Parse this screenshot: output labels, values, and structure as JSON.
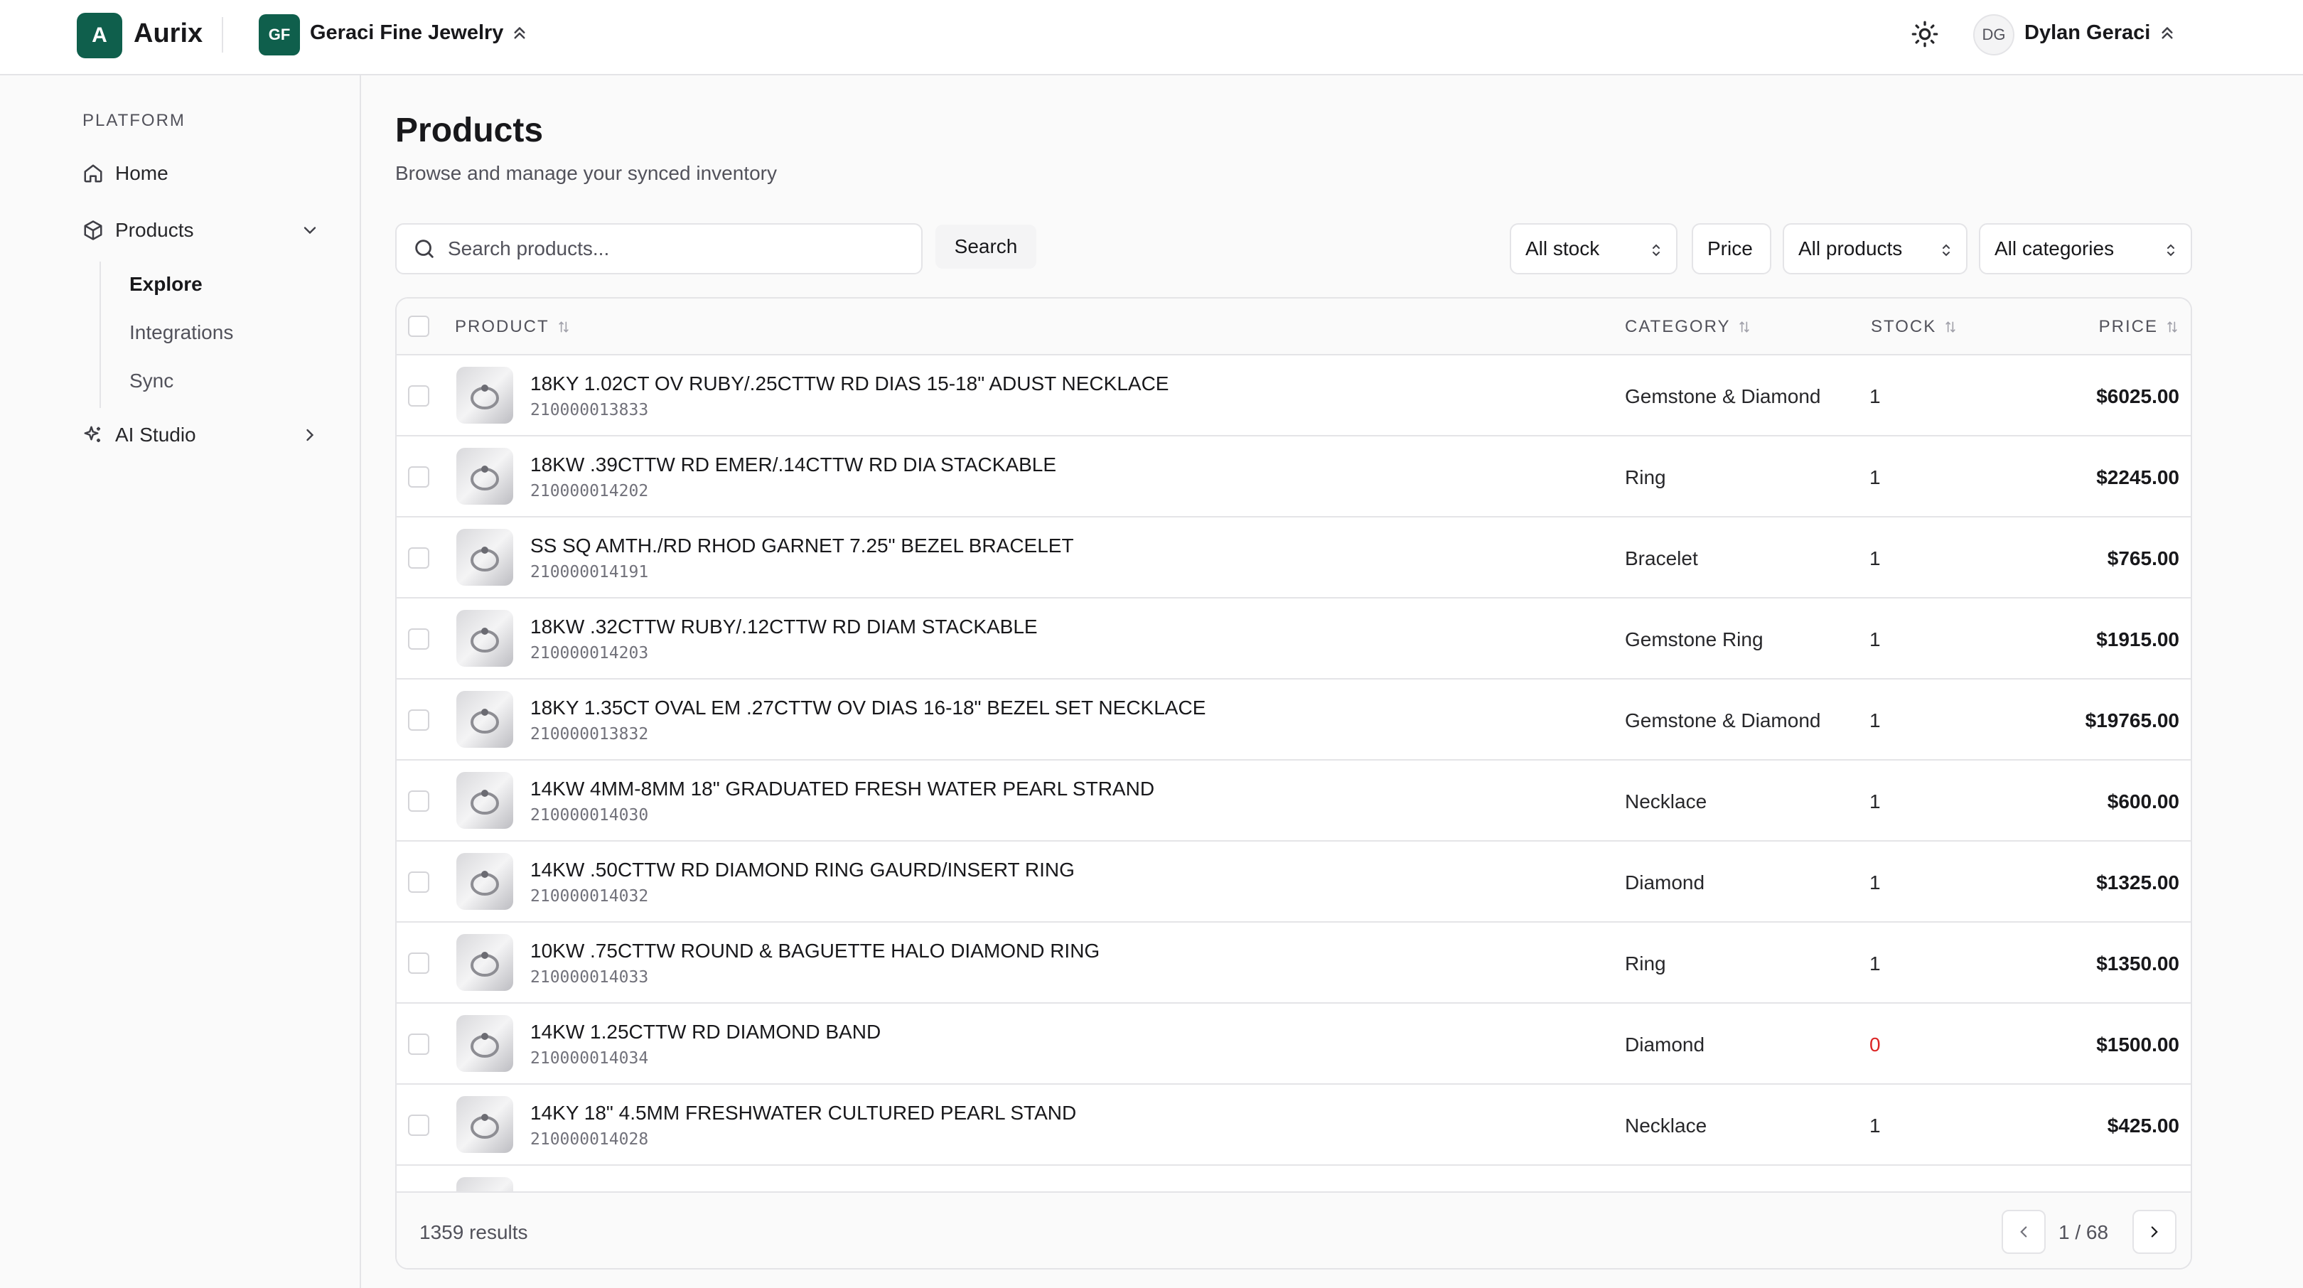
{
  "app": {
    "logo_letter": "A",
    "name": "Aurix"
  },
  "org": {
    "initials": "GF",
    "name": "Geraci Fine Jewelry"
  },
  "user": {
    "initials": "DG",
    "name": "Dylan Geraci"
  },
  "sidebar": {
    "section": "PLATFORM",
    "items": [
      {
        "label": "Home",
        "icon": "home-icon"
      },
      {
        "label": "Products",
        "icon": "box-icon"
      },
      {
        "label": "AI Studio",
        "icon": "sparkles-icon"
      }
    ],
    "subitems": [
      "Explore",
      "Integrations",
      "Sync"
    ]
  },
  "page": {
    "title": "Products",
    "subtitle": "Browse and manage your synced inventory"
  },
  "search": {
    "placeholder": "Search products...",
    "value": "",
    "button": "Search"
  },
  "filters": {
    "stock": "All stock",
    "price": "Price",
    "products": "All products",
    "categories": "All categories"
  },
  "table": {
    "columns": {
      "product": "PRODUCT",
      "category": "CATEGORY",
      "stock": "STOCK",
      "price": "PRICE"
    },
    "rows": [
      {
        "name": "18KY 1.02CT OV RUBY/.25CTTW RD DIAS 15-18\" ADUST NECKLACE",
        "sku": "210000013833",
        "category": "Gemstone & Diamond",
        "stock": "1",
        "price": "$6025.00"
      },
      {
        "name": "18KW .39CTTW RD EMER/.14CTTW RD DIA STACKABLE",
        "sku": "210000014202",
        "category": "Ring",
        "stock": "1",
        "price": "$2245.00"
      },
      {
        "name": "SS SQ AMTH./RD RHOD GARNET 7.25\" BEZEL BRACELET",
        "sku": "210000014191",
        "category": "Bracelet",
        "stock": "1",
        "price": "$765.00"
      },
      {
        "name": "18KW .32CTTW RUBY/.12CTTW RD DIAM STACKABLE",
        "sku": "210000014203",
        "category": "Gemstone Ring",
        "stock": "1",
        "price": "$1915.00"
      },
      {
        "name": "18KY 1.35CT OVAL EM .27CTTW OV DIAS 16-18\" BEZEL SET NECKLACE",
        "sku": "210000013832",
        "category": "Gemstone & Diamond",
        "stock": "1",
        "price": "$19765.00"
      },
      {
        "name": "14KW 4MM-8MM 18\" GRADUATED FRESH WATER PEARL STRAND",
        "sku": "210000014030",
        "category": "Necklace",
        "stock": "1",
        "price": "$600.00"
      },
      {
        "name": "14KW .50CTTW RD DIAMOND RING GAURD/INSERT RING",
        "sku": "210000014032",
        "category": "Diamond",
        "stock": "1",
        "price": "$1325.00"
      },
      {
        "name": "10KW .75CTTW ROUND & BAGUETTE HALO DIAMOND RING",
        "sku": "210000014033",
        "category": "Ring",
        "stock": "1",
        "price": "$1350.00"
      },
      {
        "name": "14KW 1.25CTTW RD DIAMOND BAND",
        "sku": "210000014034",
        "category": "Diamond",
        "stock": "0",
        "price": "$1500.00"
      },
      {
        "name": "14KY 18\" 4.5MM FRESHWATER CULTURED PEARL STAND",
        "sku": "210000014028",
        "category": "Necklace",
        "stock": "1",
        "price": "$425.00"
      }
    ]
  },
  "footer": {
    "results": "1359 results",
    "page": "1 / 68"
  },
  "colors": {
    "brand": "#0f5f4c",
    "out_of_stock": "#dc2626"
  }
}
